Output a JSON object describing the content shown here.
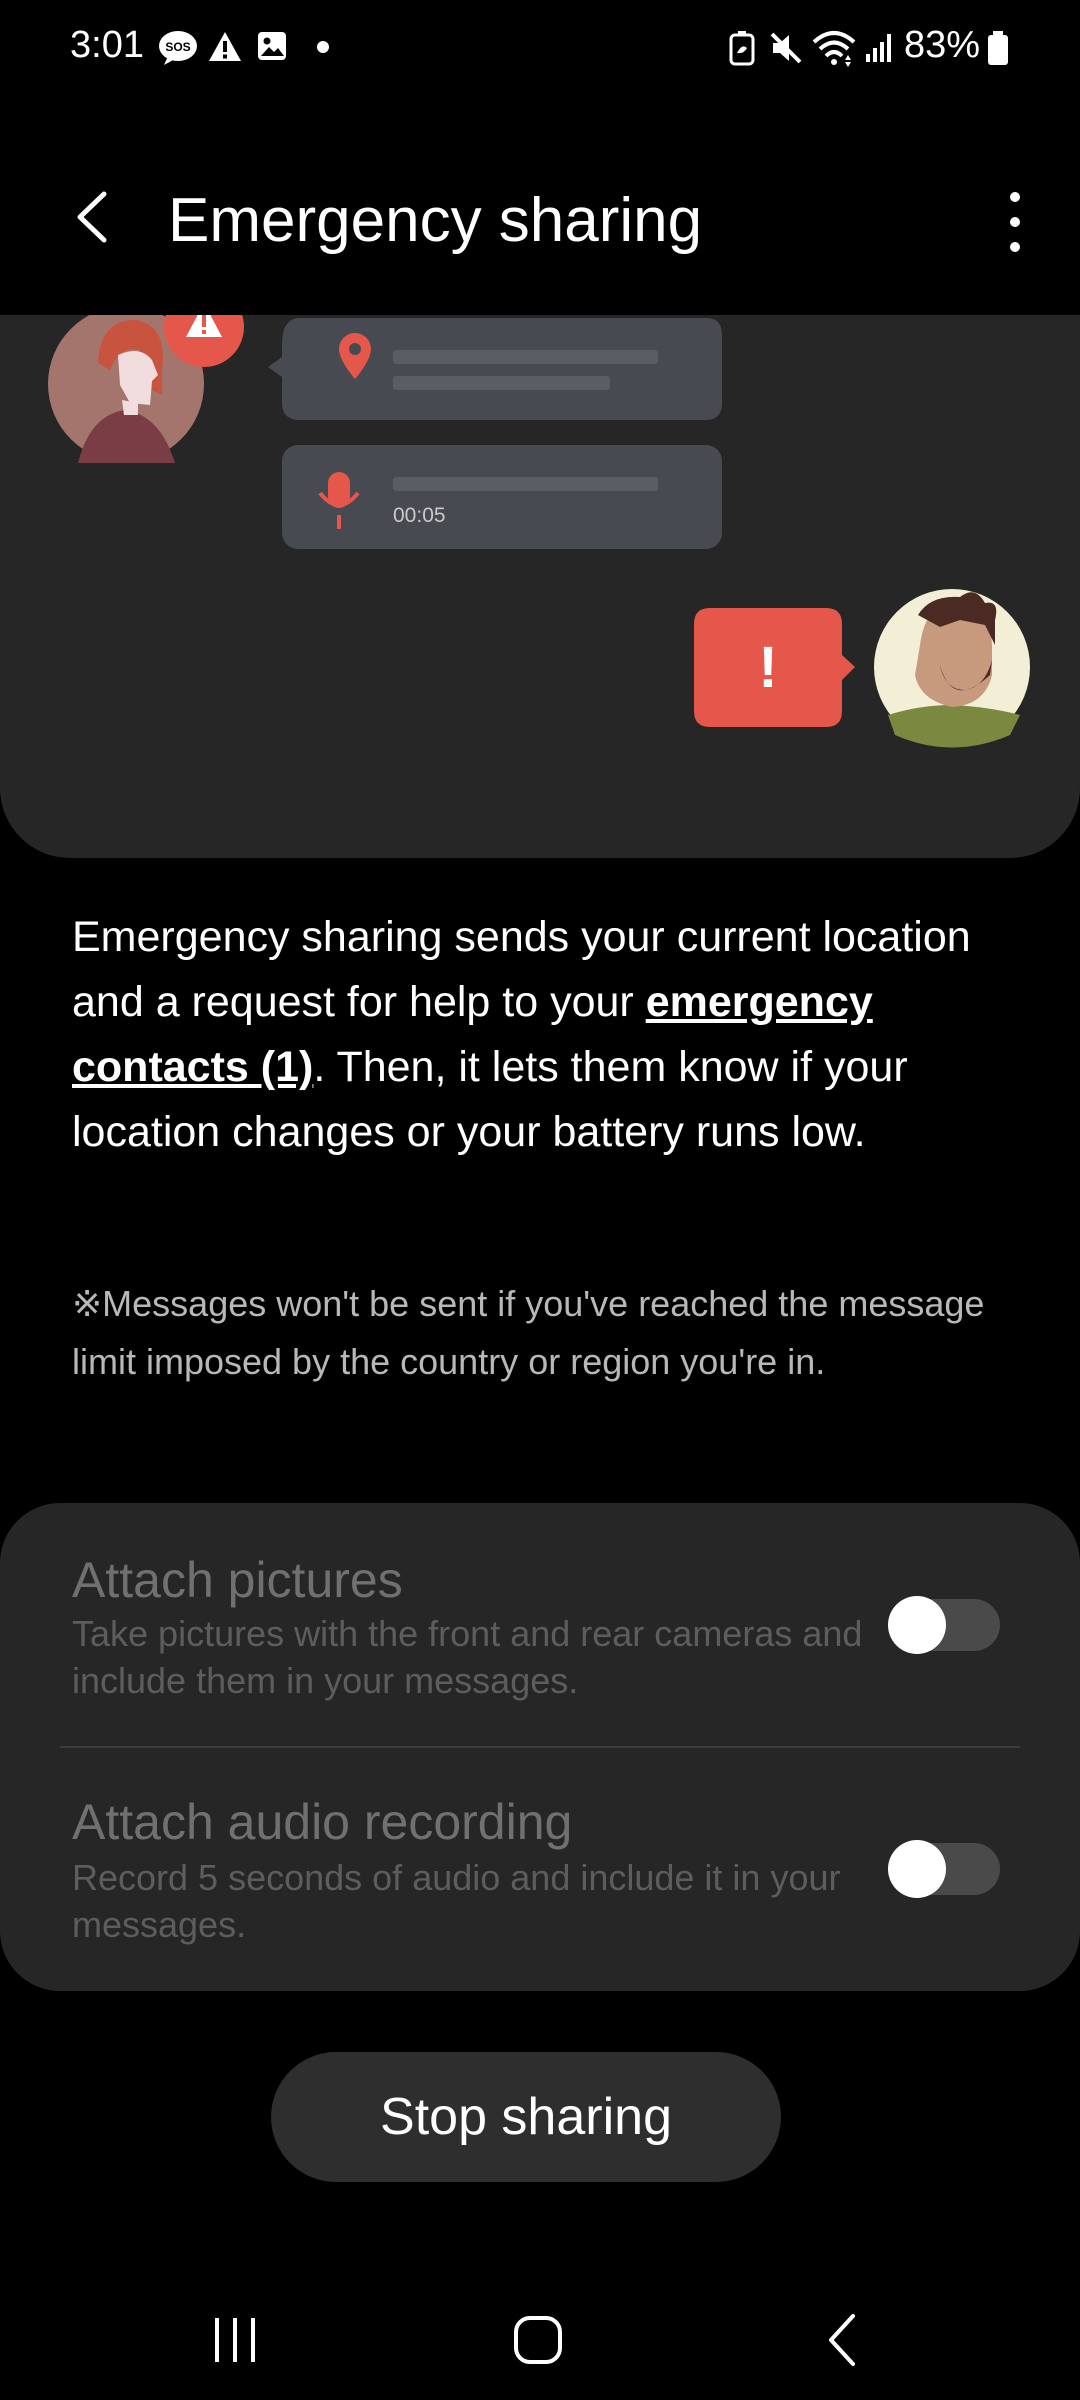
{
  "status_bar": {
    "time": "3:01",
    "battery": "83%",
    "left_icons": [
      "sos-icon",
      "warning-icon",
      "gallery-icon",
      "dot-icon"
    ],
    "right_icons": [
      "battery-saver-icon",
      "mute-icon",
      "wifi-icon",
      "signal-icon",
      "battery-icon"
    ]
  },
  "app_bar": {
    "title": "Emergency sharing",
    "back_icon": "back-arrow-icon",
    "more_icon": "more-options-icon"
  },
  "illustration": {
    "audio_duration": "00:05",
    "alert_symbol": "!"
  },
  "description": {
    "part1": "Emergency sharing sends your current location and a request for help to your ",
    "link": "emergency contacts (1)",
    "part2": ". Then, it lets them know if your location changes or your battery runs low."
  },
  "note": "※Messages won't be sent if you've reached the message limit imposed by the country or region you're in.",
  "settings": [
    {
      "title": "Attach pictures",
      "subtitle": "Take pictures with the front and rear cameras and include them in your messages.",
      "enabled": false
    },
    {
      "title": "Attach audio recording",
      "subtitle": "Record 5 seconds of audio and include it in your messages.",
      "enabled": false
    }
  ],
  "stop_button": "Stop sharing",
  "nav_bar": {
    "recents_icon": "recents-icon",
    "home_icon": "home-icon",
    "back_icon": "nav-back-icon"
  },
  "colors": {
    "accent_red": "#e5574b",
    "card_bg": "#262626",
    "bubble_bg": "#474b51"
  }
}
